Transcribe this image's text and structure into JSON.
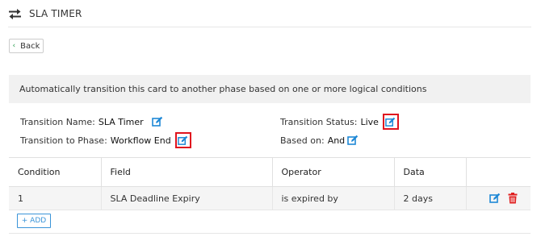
{
  "header": {
    "title": "SLA TIMER",
    "icon": "swap-arrows-icon"
  },
  "back_button": {
    "label": "Back",
    "icon": "chevron-left-icon"
  },
  "description": "Automatically transition this card to another phase based on one or more logical conditions",
  "details": {
    "transition_name": {
      "label": "Transition Name:",
      "value": "SLA Timer"
    },
    "transition_to_phase": {
      "label": "Transition to Phase:",
      "value": "Workflow End"
    },
    "transition_status": {
      "label": "Transition Status:",
      "value": "Live"
    },
    "based_on": {
      "label": "Based on:",
      "value": "And"
    }
  },
  "table": {
    "headers": [
      "Condition",
      "Field",
      "Operator",
      "Data",
      ""
    ],
    "rows": [
      {
        "condition": "1",
        "field": "SLA Deadline Expiry",
        "operator": "is expired by",
        "data": "2 days"
      }
    ]
  },
  "add_button": {
    "label": "+ ADD"
  },
  "colors": {
    "accent": "#1e88d6",
    "highlight": "#e0141e",
    "delete": "#e02020",
    "back_chevron": "#2a9d4f"
  }
}
